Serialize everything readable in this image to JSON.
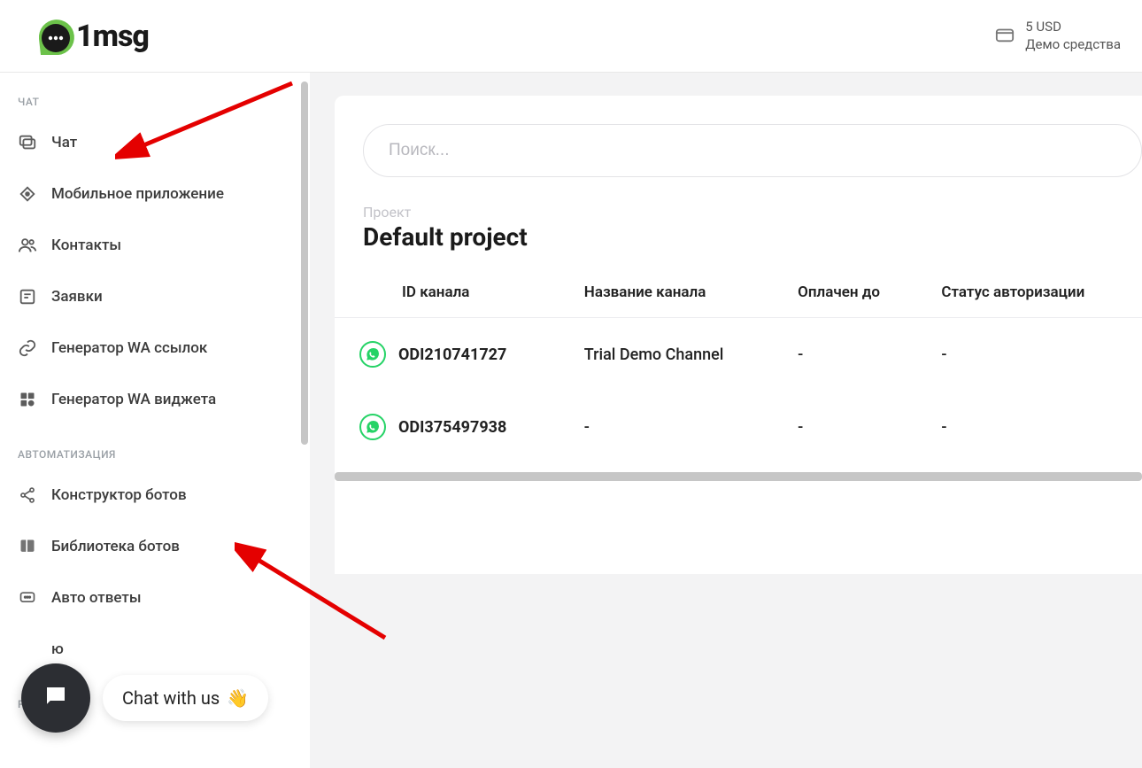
{
  "brand": {
    "name": "1msg"
  },
  "header": {
    "balance_amount": "5 USD",
    "balance_label": "Демо средства"
  },
  "sidebar": {
    "sections": [
      {
        "label": "ЧАТ",
        "items": [
          {
            "key": "chat",
            "label": "Чат",
            "icon": "chat-icon"
          },
          {
            "key": "mobile-app",
            "label": "Мобильное приложение",
            "icon": "mobile-icon"
          },
          {
            "key": "contacts",
            "label": "Контакты",
            "icon": "contacts-icon"
          },
          {
            "key": "requests",
            "label": "Заявки",
            "icon": "requests-icon"
          },
          {
            "key": "wa-link-gen",
            "label": "Генератор WA ссылок",
            "icon": "link-icon"
          },
          {
            "key": "wa-widget-gen",
            "label": "Генератор WA виджета",
            "icon": "widget-icon"
          }
        ]
      },
      {
        "label": "АВТОМАТИЗАЦИЯ",
        "items": [
          {
            "key": "bot-builder",
            "label": "Конструктор ботов",
            "icon": "share-icon"
          },
          {
            "key": "bot-library",
            "label": "Библиотека ботов",
            "icon": "book-icon"
          },
          {
            "key": "auto-replies",
            "label": "Авто ответы",
            "icon": "auto-reply-icon"
          },
          {
            "key": "truncated",
            "label": "ю",
            "icon": "blank-icon"
          }
        ]
      },
      {
        "label": "РАССЫЛКИ",
        "items": []
      }
    ]
  },
  "main": {
    "search_placeholder": "Поиск...",
    "project_label": "Проект",
    "project_name": "Default project",
    "table": {
      "columns": [
        "ID канала",
        "Название канала",
        "Оплачен до",
        "Статус авторизации"
      ],
      "rows": [
        {
          "id": "ODI210741727",
          "name": "Trial Demo Channel",
          "paid_until": "-",
          "auth_status": "-"
        },
        {
          "id": "ODI375497938",
          "name": "-",
          "paid_until": "-",
          "auth_status": "-"
        }
      ]
    }
  },
  "widget": {
    "chat_with_us": "Chat with us",
    "wave_emoji": "👋"
  }
}
